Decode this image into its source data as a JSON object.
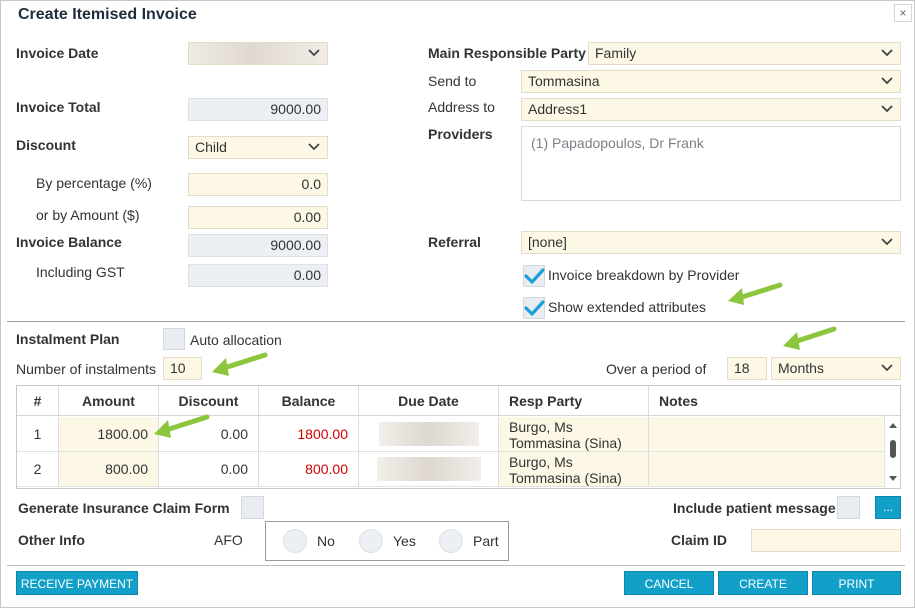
{
  "window": {
    "title": "Create Itemised Invoice",
    "close_glyph": "×"
  },
  "left": {
    "invoice_date_label": "Invoice Date",
    "invoice_total_label": "Invoice Total",
    "invoice_total_value": "9000.00",
    "discount_label": "Discount",
    "discount_value": "Child",
    "by_percentage_label": "By percentage (%)",
    "by_percentage_value": "0.0",
    "by_amount_label": "or by Amount ($)",
    "by_amount_value": "0.00",
    "invoice_balance_label": "Invoice Balance",
    "invoice_balance_value": "9000.00",
    "including_gst_label": "Including GST",
    "including_gst_value": "0.00"
  },
  "right": {
    "main_party_label": "Main Responsible Party",
    "main_party_value": "Family",
    "send_to_label": "Send to",
    "send_to_value": "Tommasina",
    "address_to_label": "Address to",
    "address_to_value": "Address1",
    "providers_label": "Providers",
    "providers_value": "(1) Papadopoulos, Dr Frank",
    "referral_label": "Referral",
    "referral_value": "[none]",
    "breakdown_label": "Invoice breakdown by Provider",
    "breakdown_checked": true,
    "extended_label": "Show extended attributes",
    "extended_checked": true
  },
  "instalment": {
    "plan_label": "Instalment Plan",
    "auto_allocation_label": "Auto allocation",
    "number_label": "Number of instalments",
    "number_value": "10",
    "period_label": "Over a period of",
    "period_value": "18",
    "period_unit": "Months"
  },
  "table": {
    "columns": [
      "#",
      "Amount",
      "Discount",
      "Balance",
      "Due Date",
      "Resp Party",
      "Notes"
    ],
    "rows": [
      {
        "num": "1",
        "amount": "1800.00",
        "discount": "0.00",
        "balance": "1800.00",
        "resp_line1": "Burgo, Ms",
        "resp_line2": "Tommasina (Sina)",
        "notes": ""
      },
      {
        "num": "2",
        "amount": "800.00",
        "discount": "0.00",
        "balance": "800.00",
        "resp_line1": "Burgo, Ms",
        "resp_line2": "Tommasina (Sina)",
        "notes": ""
      }
    ]
  },
  "bottom": {
    "generate_claim_label": "Generate Insurance Claim Form",
    "include_message_label": "Include patient message",
    "more_button": "...",
    "other_info_label": "Other Info",
    "afo_label": "AFO",
    "radio_no": "No",
    "radio_yes": "Yes",
    "radio_part": "Part",
    "claim_id_label": "Claim ID"
  },
  "buttons": {
    "receive_payment": "RECEIVE PAYMENT",
    "cancel": "CANCEL",
    "create": "CREATE",
    "print": "PRINT"
  },
  "colors": {
    "accent": "#12a0c9",
    "field_bg": "#fdf7e6",
    "readonly_bg": "#eceff3",
    "balance_red": "#d40000",
    "check_blue": "#1aa0d8",
    "annotation_arrow": "#8cc63e"
  }
}
